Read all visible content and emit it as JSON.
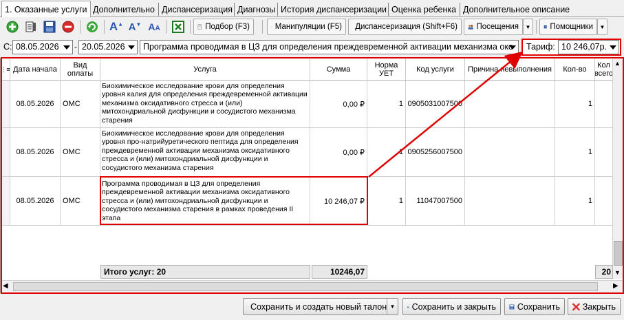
{
  "tabs": [
    {
      "label": "1. Оказанные услуги"
    },
    {
      "label": "Дополнительно"
    },
    {
      "label": "Диспансеризация"
    },
    {
      "label": "Диагнозы"
    },
    {
      "label": "История диспансеризации"
    },
    {
      "label": "Оценка ребенка"
    },
    {
      "label": "Дополнительное описание"
    }
  ],
  "toolbar": {
    "podbor": "Подбор (F3)",
    "manipulations": "Манипуляции (F5)",
    "dispanser": "Диспансеризация (Shift+F6)",
    "visits": "Посещения",
    "helpers": "Помощники"
  },
  "filter": {
    "from_label": "С:",
    "date_from": "08.05.2026",
    "dash": "-",
    "date_to": "20.05.2026",
    "program": "Программа проводимая в ЦЗ для определения преждевременной активации механизма окс",
    "tariff_label": "Тариф:",
    "tariff_value": "10 246,07р."
  },
  "columns": {
    "date": "Дата начала",
    "pay": "Вид оплаты",
    "service": "Услуга",
    "sum": "Сумма",
    "norm": "Норма УЕТ",
    "code": "Код услуги",
    "reason": "Причина невыполнения",
    "qty": "Кол-во",
    "qty_all": "Кол всего"
  },
  "rows": [
    {
      "date": "08.05.2026",
      "pay": "ОМС",
      "service": "Биохимическое исследование крови для определения уровня калия для определения преждевременной активации механизма оксидативного стресса и (или) митохондриальной дисфункции и сосудистого механизма старения",
      "sum": "0,00 ₽",
      "norm": "1",
      "code": "0905031007500",
      "qty": "1"
    },
    {
      "date": "08.05.2026",
      "pay": "ОМС",
      "service": "Биохимическое исследование крови для определения уровня про-натрийуретического пептида для определения преждевременной активации механизма оксидативного стресса и (или) митохондриальной дисфункции и сосудистого механизма старения",
      "sum": "0,00 ₽",
      "norm": "1",
      "code": "0905256007500",
      "qty": "1"
    },
    {
      "date": "08.05.2026",
      "pay": "ОМС",
      "service": "Программа проводимая в ЦЗ для определения преждевременной активации механизма оксидативного стресса и (или) митохондриальной дисфункции и сосудистого механизма старения в рамках проведения II этапа",
      "sum": "10 246,07 ₽",
      "norm": "1",
      "code": "11047007500",
      "qty": "1"
    }
  ],
  "totals": {
    "label": "Итого услуг: 20",
    "sum": "10246,07",
    "qty": "20"
  },
  "buttons": {
    "save_new": "Сохранить и создать новый талон",
    "save_close": "Сохранить и закрыть",
    "save": "Сохранить",
    "close": "Закрыть"
  },
  "colors": {
    "highlight": "#e00000",
    "accent_green": "#2e9e2e"
  }
}
